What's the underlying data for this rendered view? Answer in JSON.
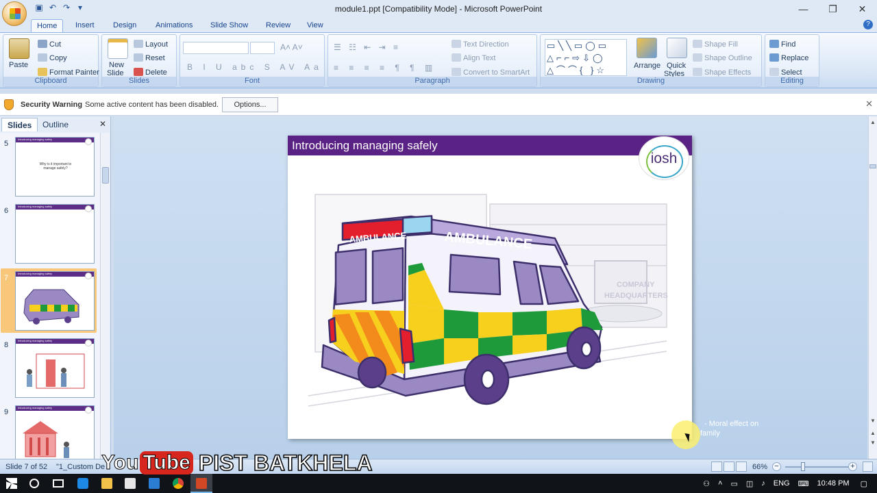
{
  "window": {
    "title": "module1.ppt [Compatibility Mode] - Microsoft PowerPoint",
    "minimize": "—",
    "restore": "❐",
    "close": "✕"
  },
  "quick_access": [
    "save",
    "undo",
    "redo"
  ],
  "tabs": [
    "Home",
    "Insert",
    "Design",
    "Animations",
    "Slide Show",
    "Review",
    "View"
  ],
  "ribbon": {
    "clipboard": {
      "paste": "Paste",
      "cut": "Cut",
      "copy": "Copy",
      "format_painter": "Format Painter",
      "label": "Clipboard"
    },
    "slides": {
      "new_slide": "New",
      "new_slide_2": "Slide",
      "layout": "Layout",
      "reset": "Reset",
      "delete": "Delete",
      "label": "Slides"
    },
    "font": {
      "label": "Font"
    },
    "paragraph": {
      "text_direction": "Text Direction",
      "align_text": "Align Text",
      "convert_smartart": "Convert to SmartArt",
      "label": "Paragraph"
    },
    "drawing": {
      "arrange": "Arrange",
      "quick_styles": "Quick",
      "quick_styles_2": "Styles",
      "shape_fill": "Shape Fill",
      "shape_outline": "Shape Outline",
      "shape_effects": "Shape Effects",
      "label": "Drawing"
    },
    "editing": {
      "find": "Find",
      "replace": "Replace",
      "select": "Select",
      "label": "Editing"
    }
  },
  "security": {
    "title": "Security Warning",
    "message": "Some active content has been disabled.",
    "options": "Options..."
  },
  "panel": {
    "tabs": [
      "Slides",
      "Outline"
    ],
    "thumbnails": [
      {
        "num": "5",
        "header": "Introducing managing safely",
        "text": "Why is it important to manage safely?"
      },
      {
        "num": "6",
        "header": "Introducing managing safely",
        "text": ""
      },
      {
        "num": "7",
        "header": "Introducing managing safely",
        "text": ""
      },
      {
        "num": "8",
        "header": "Introducing managing safely",
        "text": ""
      },
      {
        "num": "9",
        "header": "Introducing managing safely",
        "text": ""
      }
    ]
  },
  "slide": {
    "title": "Introducing managing safely",
    "logo": "iosh",
    "ambulance_text_1": "AMBULANCE",
    "ambulance_text_2": "AMBULANCE",
    "sign_text_1": "COMPANY",
    "sign_text_2": "HEADQUARTERS"
  },
  "notes": {
    "line1": "- Moral effect on",
    "line2": "family"
  },
  "status": {
    "slide_count": "Slide 7 of 52",
    "theme": "\"1_Custom De",
    "zoom": "66%"
  },
  "watermark": {
    "you": "You",
    "tube": "Tube",
    "channel": "PIST BATKHELA"
  },
  "taskbar": {
    "language": "ENG",
    "time": "10:48 PM"
  },
  "colors": {
    "slide_header": "#5b2286",
    "ribbon_tab_text": "#15428b",
    "ambulance_body": "#9b89c4",
    "check_green": "#1f9a3a",
    "check_yellow": "#f7cf1d"
  }
}
